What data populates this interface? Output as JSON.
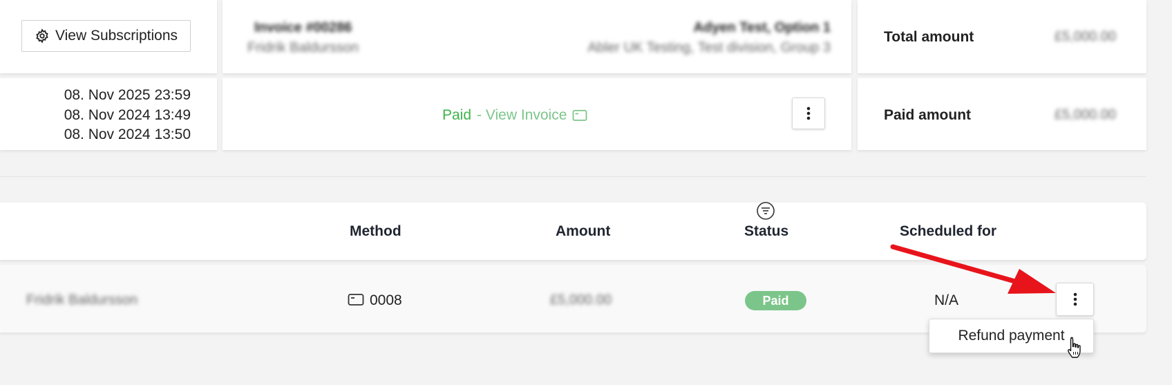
{
  "subscriptions": {
    "button_label": "View Subscriptions",
    "icon": "gear-icon"
  },
  "invoice": {
    "number": "Invoice #00286",
    "customer_name": "Fridrik Baldursson",
    "company_name": "Adyen Test, Option 1",
    "company_detail": "Abler UK Testing, Test division, Group 3"
  },
  "dates": [
    "08. Nov 2025 23:59",
    "08. Nov 2024 13:49",
    "08. Nov 2024 13:50"
  ],
  "payment_status": {
    "status": "Paid",
    "link_text": "- View Invoice"
  },
  "totals": {
    "total_label": "Total amount",
    "total_value": "£5,000.00",
    "paid_label": "Paid amount",
    "paid_value": "£5,000.00"
  },
  "payments_table": {
    "headers": {
      "method": "Method",
      "amount": "Amount",
      "status": "Status",
      "scheduled": "Scheduled for"
    },
    "row": {
      "payer": "Fridrik Baldursson",
      "card_last4": "0008",
      "amount": "£5,000.00",
      "status": "Paid",
      "scheduled": "N/A"
    }
  },
  "row_menu": {
    "items": [
      "Refund payment"
    ]
  },
  "colors": {
    "paid_green": "#3db54a",
    "link_green": "#7cc58a",
    "badge_green": "#7cc58a",
    "arrow_red": "#e8141b"
  }
}
